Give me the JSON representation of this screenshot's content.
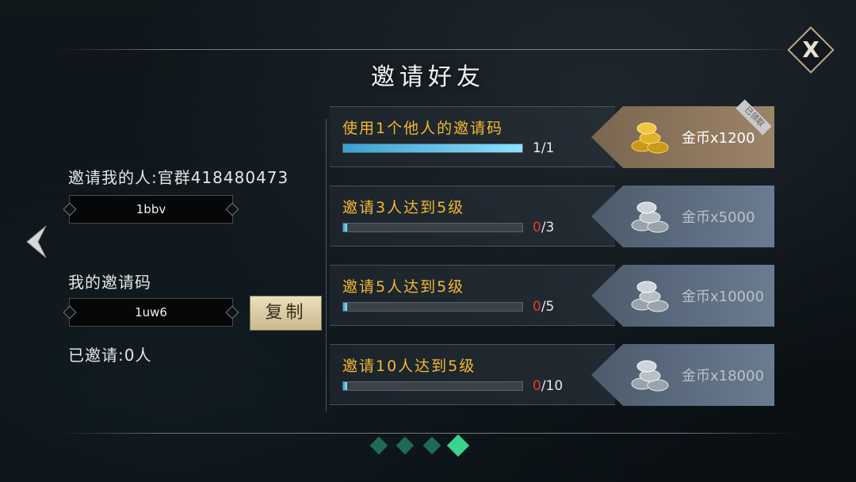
{
  "title": "邀请好友",
  "close": {
    "label": "X",
    "icon": "close-icon"
  },
  "back": {
    "icon": "left-arrow-icon"
  },
  "left": {
    "inviter_label": "邀请我的人:官群418480473",
    "inviter_value": "1bbv",
    "my_code_label": "我的邀请码",
    "my_code_value": "1uw6",
    "copy_label": "复制",
    "invited_count": "已邀请:0人"
  },
  "tasks": [
    {
      "title": "使用1个他人的邀请码",
      "current": "1",
      "total": "/1",
      "progress": 1.0,
      "reward": "金币x1200",
      "coin": "gold",
      "claimed": "已领取"
    },
    {
      "title": "邀请3人达到5级",
      "current": "0",
      "total": "/3",
      "progress": 0.0,
      "reward": "金币x5000",
      "coin": "silver"
    },
    {
      "title": "邀请5人达到5级",
      "current": "0",
      "total": "/5",
      "progress": 0.0,
      "reward": "金币x10000",
      "coin": "silver"
    },
    {
      "title": "邀请10人达到5级",
      "current": "0",
      "total": "/10",
      "progress": 0.0,
      "reward": "金币x18000",
      "coin": "silver"
    }
  ],
  "pagination": {
    "pages": 4,
    "active": 4
  },
  "colors": {
    "task_title": "#f5b830",
    "progress": "#5cc8f0",
    "zero": "#e03a2a",
    "gold_panel": "#8a735c",
    "silver_panel": "#5b6b7c"
  }
}
